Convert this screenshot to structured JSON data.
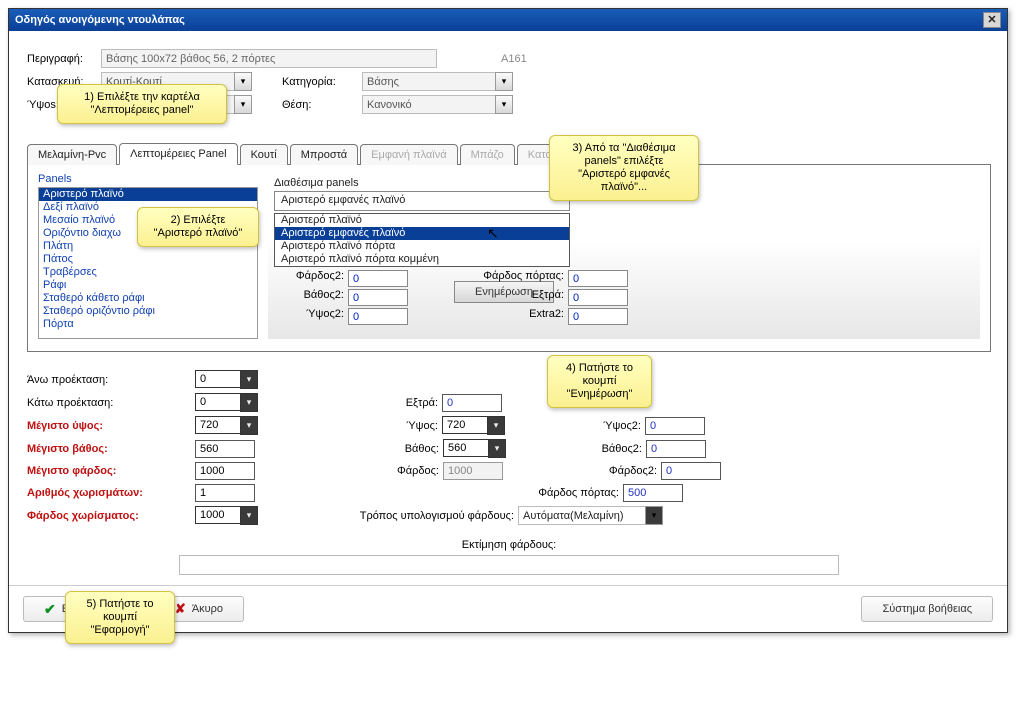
{
  "title": "Οδηγός ανοιγόμενης ντουλάπας",
  "header": {
    "perigrafLabel": "Περιγραφή:",
    "perigrafValue": "Βάσης 100x72 βάθος 56, 2 πόρτες",
    "code": "A161",
    "kataskeviLabel": "Κατασκευή:",
    "kataskeviValue": "Κουτί-Κουτί",
    "katigLabel": "Κατηγορία:",
    "katigValue": "Βάσης",
    "ypsosLabel": "Ύψos:",
    "thesiLabel": "Θέση:",
    "thesiValue": "Κανονικό"
  },
  "tabs": [
    "Μελαμίνη-Pvc",
    "Λεπτομέρειες Panel",
    "Κουτί",
    "Μπροστά",
    "Εμφανή πλαϊνά",
    "Μπάζο",
    "Καταφρ..."
  ],
  "panels": {
    "title": "Panels",
    "items": [
      "Αριστερό πλαϊνό",
      "Δεξί πλαϊνό",
      "Μεσαίο πλαϊνό",
      "Οριζόντιο διαχω",
      "Πλάτη",
      "Πάτος",
      "Τραβέρσες",
      "Ράφι",
      "Σταθερό κάθετο ράφι",
      "Σταθερό οριζόντιο ράφι",
      "Πόρτα"
    ]
  },
  "available": {
    "title": "Διαθέσιμα panels",
    "selected": "Αριστερό εμφανές πλαϊνό",
    "options": [
      "Αριστερό πλαϊνό",
      "Αριστερό εμφανές πλαϊνό",
      "Αριστερό πλαϊνό πόρτα",
      "Αριστερό πλαϊνό πόρτα κομμένη"
    ]
  },
  "fields": {
    "fardos2": "Φάρδος2:",
    "fardosPortas": "Φάρδος πόρτας:",
    "vathos2": "Βάθος2:",
    "extra": "Εξτρά:",
    "ypsos2l": "Ύψος2:",
    "extra2": "Extra2:",
    "vals": {
      "fardos2": "0",
      "fardosPortas": "0",
      "vathos2": "0",
      "extra": "0",
      "ypsos2": "0",
      "extra2v": "0"
    }
  },
  "updateBtn": "Ενημέρωση",
  "lower": {
    "anwLabel": "Άνω προέκταση:",
    "anw": "0",
    "katwLabel": "Κάτω προέκταση:",
    "katw": "0",
    "extraLabel": "Εξτρά:",
    "extra": "0",
    "maxYpsLabel": "Μέγιστο ύψος:",
    "maxYps": "720",
    "ypsosLabel": "Ύψος:",
    "ypsos": "720",
    "ypsos2Label": "Ύψος2:",
    "ypsos2": "0",
    "maxVathLabel": "Μέγιστο βάθος:",
    "maxVath": "560",
    "vathosLabel": "Βάθος:",
    "vathos": "560",
    "vathos2Label": "Βάθος2:",
    "vathos2": "0",
    "maxFardLabel": "Μέγιστο φάρδος:",
    "maxFard": "1000",
    "fardosLabel": "Φάρδος:",
    "fardos": "1000",
    "fardos2Label": "Φάρδος2:",
    "fardos2": "0",
    "arithXorLabel": "Αριθμός χωρισμάτων:",
    "arithXor": "1",
    "fardosPortasLabel": "Φάρδος πόρτας:",
    "fardosPortas": "500",
    "fardXorLabel": "Φάρδος χωρίσματος:",
    "fardXor": "1000",
    "troposLabel": "Τρόπος υπολογισμού φάρδους:",
    "tropos": "Αυτόματα(Μελαμίνη)",
    "ektimLabel": "Εκτίμηση φάρδους:"
  },
  "callouts": {
    "c1": "1) Επιλέξτε την καρτέλα \"Λεπτομέρειες panel\"",
    "c2": "2) Επιλέξτε \"Αριστερό πλαϊνό\"",
    "c3": "3) Από τα \"Διαθέσιμα panels\" επιλέξτε \"Αριστερό εμφανές πλαϊνό\"...",
    "c4": "4) Πατήστε το κουμπί \"Ενημέρωση\"",
    "c5": "5) Πατήστε το κουμπί \"Εφαρμογή\""
  },
  "buttons": {
    "apply": "Εφαρμογή",
    "cancel": "Άκυρο",
    "help": "Σύστημα βοήθειας"
  }
}
